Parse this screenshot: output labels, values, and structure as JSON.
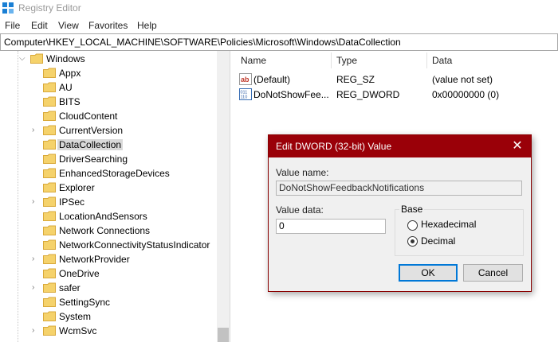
{
  "window": {
    "title": "Registry Editor"
  },
  "menu": [
    "File",
    "Edit",
    "View",
    "Favorites",
    "Help"
  ],
  "address": "Computer\\HKEY_LOCAL_MACHINE\\SOFTWARE\\Policies\\Microsoft\\Windows\\DataCollection",
  "tree": {
    "root": "Windows",
    "items": [
      {
        "label": "Appx",
        "expandable": false
      },
      {
        "label": "AU",
        "expandable": false
      },
      {
        "label": "BITS",
        "expandable": false
      },
      {
        "label": "CloudContent",
        "expandable": false
      },
      {
        "label": "CurrentVersion",
        "expandable": true
      },
      {
        "label": "DataCollection",
        "expandable": false,
        "selected": true
      },
      {
        "label": "DriverSearching",
        "expandable": false
      },
      {
        "label": "EnhancedStorageDevices",
        "expandable": false
      },
      {
        "label": "Explorer",
        "expandable": false
      },
      {
        "label": "IPSec",
        "expandable": true
      },
      {
        "label": "LocationAndSensors",
        "expandable": false
      },
      {
        "label": "Network Connections",
        "expandable": false
      },
      {
        "label": "NetworkConnectivityStatusIndicator",
        "expandable": false
      },
      {
        "label": "NetworkProvider",
        "expandable": true
      },
      {
        "label": "OneDrive",
        "expandable": false
      },
      {
        "label": "safer",
        "expandable": true
      },
      {
        "label": "SettingSync",
        "expandable": false
      },
      {
        "label": "System",
        "expandable": false
      },
      {
        "label": "WcmSvc",
        "expandable": true
      }
    ]
  },
  "list": {
    "headers": {
      "name": "Name",
      "type": "Type",
      "data": "Data"
    },
    "rows": [
      {
        "icon": "string-value-icon",
        "name": "(Default)",
        "type": "REG_SZ",
        "data": "(value not set)"
      },
      {
        "icon": "dword-value-icon",
        "name": "DoNotShowFee...",
        "type": "REG_DWORD",
        "data": "0x00000000 (0)"
      }
    ]
  },
  "dialog": {
    "title": "Edit DWORD (32-bit) Value",
    "value_name_label": "Value name:",
    "value_name": "DoNotShowFeedbackNotifications",
    "value_data_label": "Value data:",
    "value_data": "0",
    "base_label": "Base",
    "base_options": [
      "Hexadecimal",
      "Decimal"
    ],
    "base_selected": "Decimal",
    "ok_label": "OK",
    "cancel_label": "Cancel"
  },
  "colors": {
    "dialog_title": "#9a0008",
    "default_button_border": "#0078d7",
    "folder": "#f5d26b"
  }
}
